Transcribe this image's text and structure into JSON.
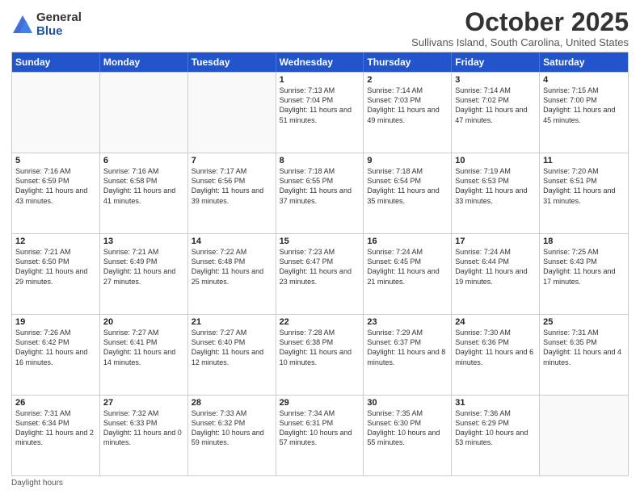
{
  "logo": {
    "general": "General",
    "blue": "Blue"
  },
  "header": {
    "month": "October 2025",
    "location": "Sullivans Island, South Carolina, United States"
  },
  "days_of_week": [
    "Sunday",
    "Monday",
    "Tuesday",
    "Wednesday",
    "Thursday",
    "Friday",
    "Saturday"
  ],
  "weeks": [
    [
      {
        "day": "",
        "info": ""
      },
      {
        "day": "",
        "info": ""
      },
      {
        "day": "",
        "info": ""
      },
      {
        "day": "1",
        "info": "Sunrise: 7:13 AM\nSunset: 7:04 PM\nDaylight: 11 hours and 51 minutes."
      },
      {
        "day": "2",
        "info": "Sunrise: 7:14 AM\nSunset: 7:03 PM\nDaylight: 11 hours and 49 minutes."
      },
      {
        "day": "3",
        "info": "Sunrise: 7:14 AM\nSunset: 7:02 PM\nDaylight: 11 hours and 47 minutes."
      },
      {
        "day": "4",
        "info": "Sunrise: 7:15 AM\nSunset: 7:00 PM\nDaylight: 11 hours and 45 minutes."
      }
    ],
    [
      {
        "day": "5",
        "info": "Sunrise: 7:16 AM\nSunset: 6:59 PM\nDaylight: 11 hours and 43 minutes."
      },
      {
        "day": "6",
        "info": "Sunrise: 7:16 AM\nSunset: 6:58 PM\nDaylight: 11 hours and 41 minutes."
      },
      {
        "day": "7",
        "info": "Sunrise: 7:17 AM\nSunset: 6:56 PM\nDaylight: 11 hours and 39 minutes."
      },
      {
        "day": "8",
        "info": "Sunrise: 7:18 AM\nSunset: 6:55 PM\nDaylight: 11 hours and 37 minutes."
      },
      {
        "day": "9",
        "info": "Sunrise: 7:18 AM\nSunset: 6:54 PM\nDaylight: 11 hours and 35 minutes."
      },
      {
        "day": "10",
        "info": "Sunrise: 7:19 AM\nSunset: 6:53 PM\nDaylight: 11 hours and 33 minutes."
      },
      {
        "day": "11",
        "info": "Sunrise: 7:20 AM\nSunset: 6:51 PM\nDaylight: 11 hours and 31 minutes."
      }
    ],
    [
      {
        "day": "12",
        "info": "Sunrise: 7:21 AM\nSunset: 6:50 PM\nDaylight: 11 hours and 29 minutes."
      },
      {
        "day": "13",
        "info": "Sunrise: 7:21 AM\nSunset: 6:49 PM\nDaylight: 11 hours and 27 minutes."
      },
      {
        "day": "14",
        "info": "Sunrise: 7:22 AM\nSunset: 6:48 PM\nDaylight: 11 hours and 25 minutes."
      },
      {
        "day": "15",
        "info": "Sunrise: 7:23 AM\nSunset: 6:47 PM\nDaylight: 11 hours and 23 minutes."
      },
      {
        "day": "16",
        "info": "Sunrise: 7:24 AM\nSunset: 6:45 PM\nDaylight: 11 hours and 21 minutes."
      },
      {
        "day": "17",
        "info": "Sunrise: 7:24 AM\nSunset: 6:44 PM\nDaylight: 11 hours and 19 minutes."
      },
      {
        "day": "18",
        "info": "Sunrise: 7:25 AM\nSunset: 6:43 PM\nDaylight: 11 hours and 17 minutes."
      }
    ],
    [
      {
        "day": "19",
        "info": "Sunrise: 7:26 AM\nSunset: 6:42 PM\nDaylight: 11 hours and 16 minutes."
      },
      {
        "day": "20",
        "info": "Sunrise: 7:27 AM\nSunset: 6:41 PM\nDaylight: 11 hours and 14 minutes."
      },
      {
        "day": "21",
        "info": "Sunrise: 7:27 AM\nSunset: 6:40 PM\nDaylight: 11 hours and 12 minutes."
      },
      {
        "day": "22",
        "info": "Sunrise: 7:28 AM\nSunset: 6:38 PM\nDaylight: 11 hours and 10 minutes."
      },
      {
        "day": "23",
        "info": "Sunrise: 7:29 AM\nSunset: 6:37 PM\nDaylight: 11 hours and 8 minutes."
      },
      {
        "day": "24",
        "info": "Sunrise: 7:30 AM\nSunset: 6:36 PM\nDaylight: 11 hours and 6 minutes."
      },
      {
        "day": "25",
        "info": "Sunrise: 7:31 AM\nSunset: 6:35 PM\nDaylight: 11 hours and 4 minutes."
      }
    ],
    [
      {
        "day": "26",
        "info": "Sunrise: 7:31 AM\nSunset: 6:34 PM\nDaylight: 11 hours and 2 minutes."
      },
      {
        "day": "27",
        "info": "Sunrise: 7:32 AM\nSunset: 6:33 PM\nDaylight: 11 hours and 0 minutes."
      },
      {
        "day": "28",
        "info": "Sunrise: 7:33 AM\nSunset: 6:32 PM\nDaylight: 10 hours and 59 minutes."
      },
      {
        "day": "29",
        "info": "Sunrise: 7:34 AM\nSunset: 6:31 PM\nDaylight: 10 hours and 57 minutes."
      },
      {
        "day": "30",
        "info": "Sunrise: 7:35 AM\nSunset: 6:30 PM\nDaylight: 10 hours and 55 minutes."
      },
      {
        "day": "31",
        "info": "Sunrise: 7:36 AM\nSunset: 6:29 PM\nDaylight: 10 hours and 53 minutes."
      },
      {
        "day": "",
        "info": ""
      }
    ]
  ],
  "footer": {
    "note": "Daylight hours"
  }
}
